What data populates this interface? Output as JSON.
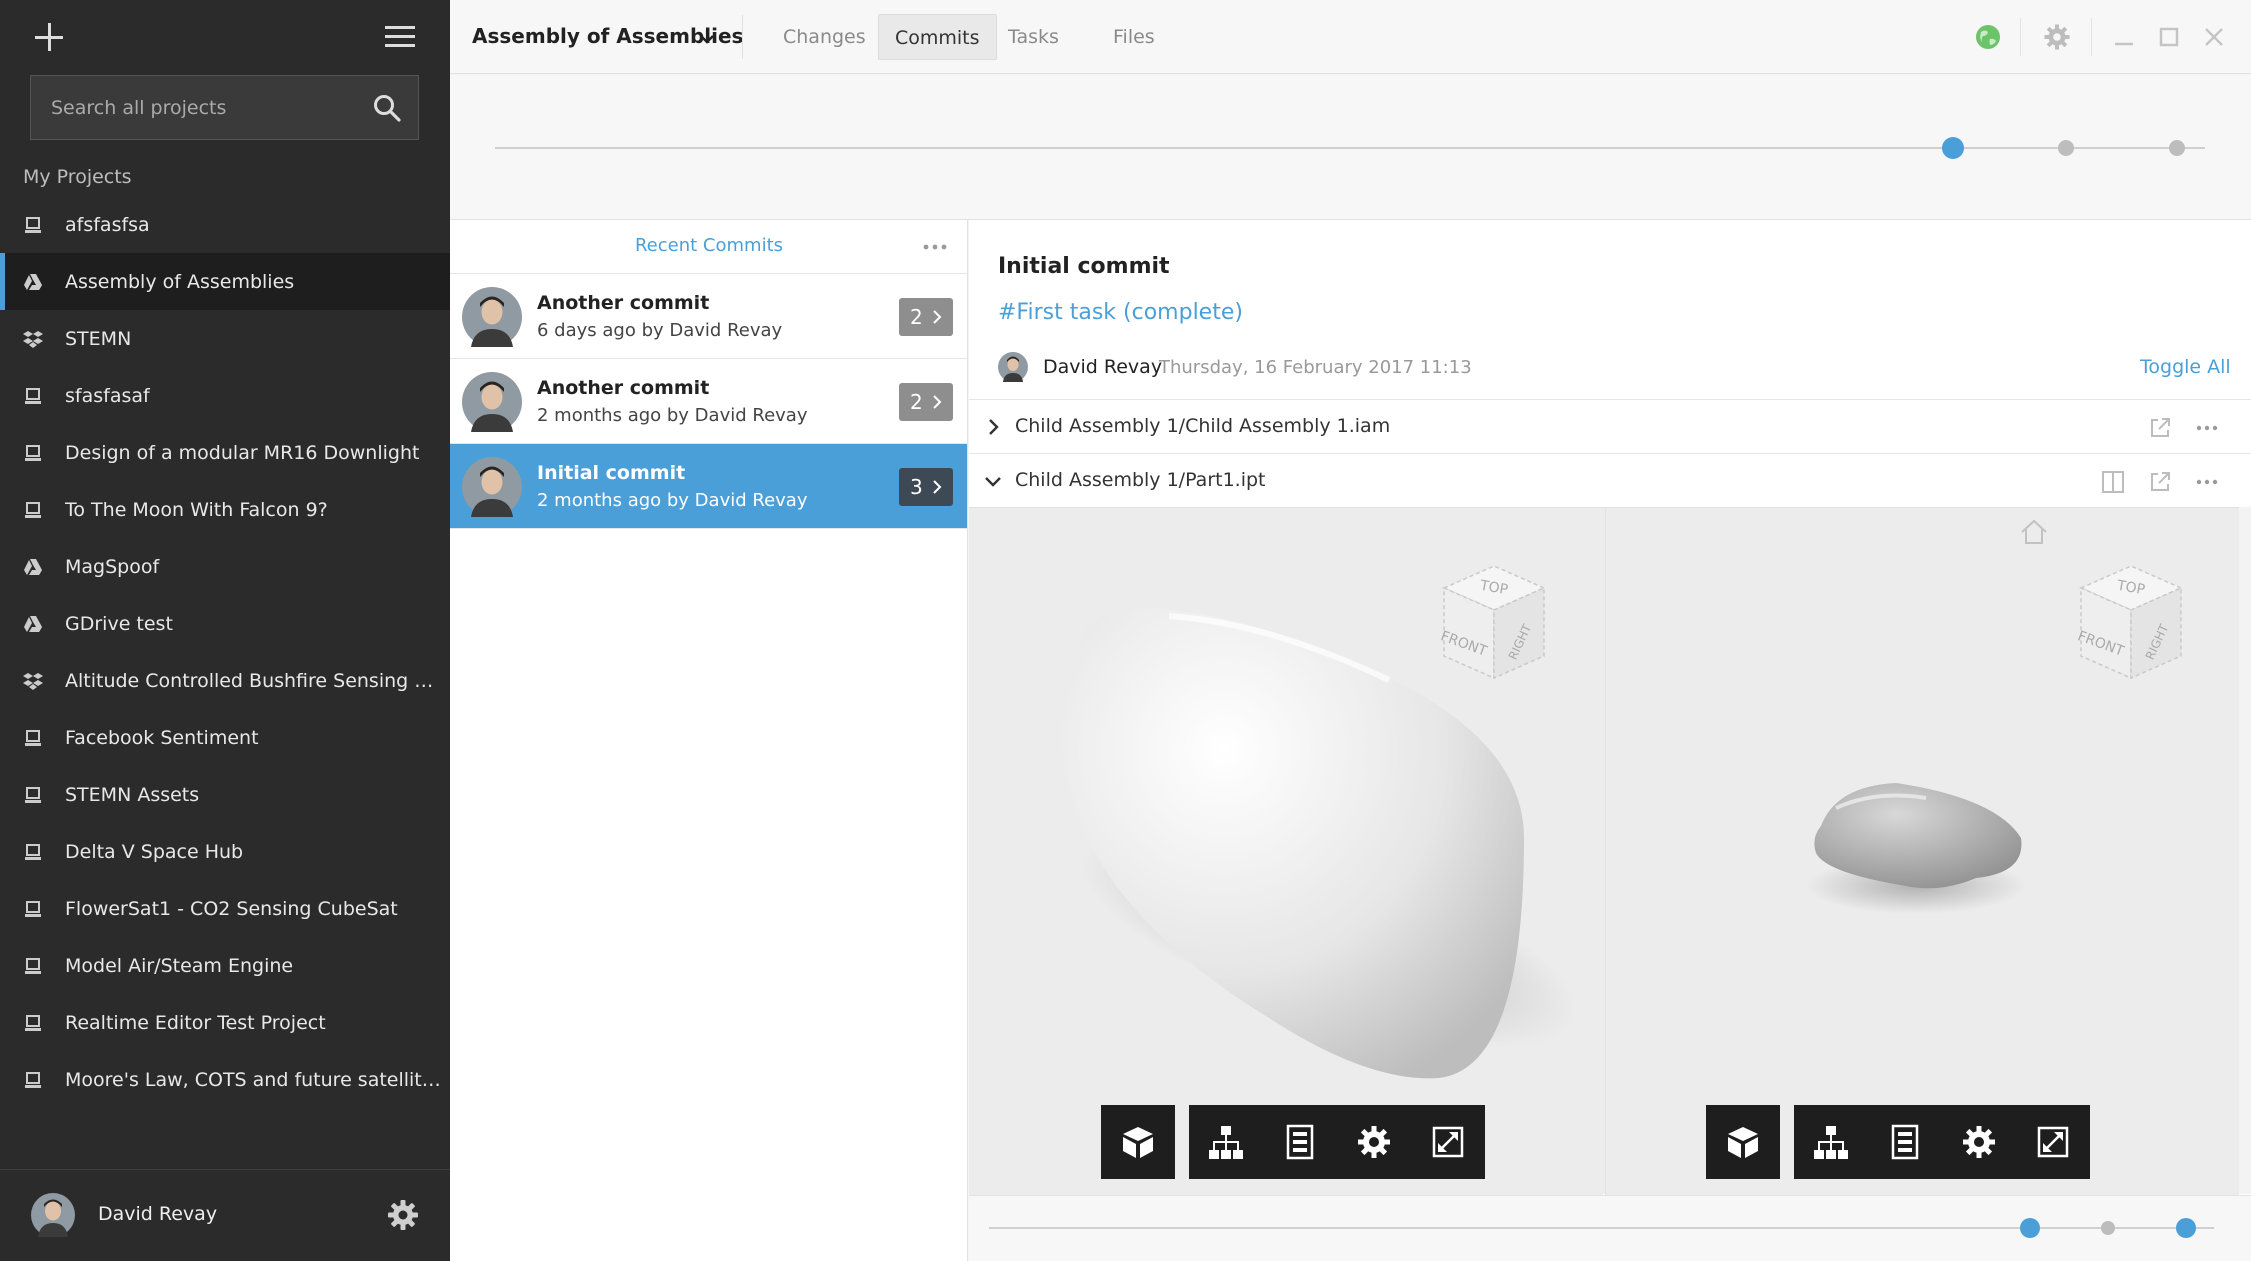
{
  "sidebar": {
    "search_placeholder": "Search all projects",
    "section_label": "My Projects",
    "projects": [
      {
        "name": "afsfasfsa",
        "icon": "laptop-icon"
      },
      {
        "name": "Assembly of Assemblies",
        "icon": "google-drive-icon",
        "active": true
      },
      {
        "name": "STEMN",
        "icon": "dropbox-icon"
      },
      {
        "name": "sfasfasaf",
        "icon": "laptop-icon"
      },
      {
        "name": "Design of a modular MR16 Downlight",
        "icon": "laptop-icon"
      },
      {
        "name": "To The Moon With Falcon 9?",
        "icon": "laptop-icon"
      },
      {
        "name": "MagSpoof",
        "icon": "google-drive-icon"
      },
      {
        "name": "GDrive test",
        "icon": "google-drive-icon"
      },
      {
        "name": "Altitude Controlled Bushfire Sensing Ballo...",
        "icon": "dropbox-icon"
      },
      {
        "name": "Facebook Sentiment",
        "icon": "laptop-icon"
      },
      {
        "name": "STEMN Assets",
        "icon": "laptop-icon"
      },
      {
        "name": "Delta V Space Hub",
        "icon": "laptop-icon"
      },
      {
        "name": "FlowerSat1 - CO2 Sensing CubeSat",
        "icon": "laptop-icon"
      },
      {
        "name": "Model Air/Steam Engine",
        "icon": "laptop-icon"
      },
      {
        "name": "Realtime Editor Test Project",
        "icon": "laptop-icon"
      },
      {
        "name": "Moore's Law, COTS and future satellite in...",
        "icon": "laptop-icon"
      }
    ],
    "user_name": "David Revay"
  },
  "topbar": {
    "project_title": "Assembly of Assemblies",
    "tabs": [
      {
        "label": "Changes"
      },
      {
        "label": "Commits",
        "active": true
      },
      {
        "label": "Tasks"
      },
      {
        "label": "Files"
      }
    ]
  },
  "commits": {
    "header": "Recent Commits",
    "items": [
      {
        "title": "Another commit",
        "subtitle": "6 days ago by David Revay",
        "count": "2"
      },
      {
        "title": "Another commit",
        "subtitle": "2 months ago by David Revay",
        "count": "2"
      },
      {
        "title": "Initial commit",
        "subtitle": "2 months ago by David Revay",
        "count": "3",
        "selected": true
      }
    ]
  },
  "details": {
    "title": "Initial commit",
    "task": "#First task (complete)",
    "author": "David Revay",
    "date": "Thursday, 16 February 2017 11:13",
    "toggle_all": "Toggle All",
    "files": [
      {
        "name": "Child Assembly 1/Child Assembly 1.iam",
        "expanded": false
      },
      {
        "name": "Child Assembly 1/Part1.ipt",
        "expanded": true
      }
    ],
    "viewcube": {
      "top": "TOP",
      "front": "FRONT",
      "right": "RIGHT"
    }
  },
  "colors": {
    "accent": "#4a9fd8",
    "sidebar_bg": "#2b2b2b",
    "toolbar_bg": "#1e1e1e",
    "status_green": "#6cc46a"
  }
}
